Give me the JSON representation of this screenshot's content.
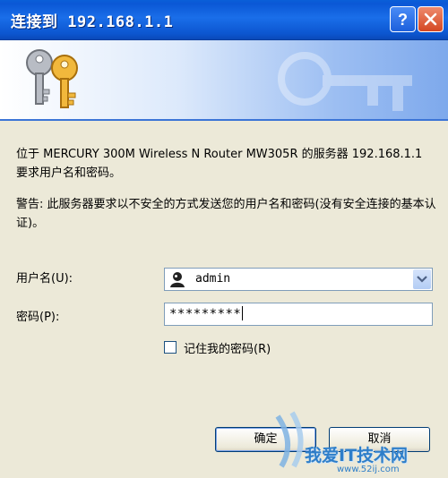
{
  "window": {
    "title": "连接到 192.168.1.1",
    "help_icon": "help-icon",
    "close_icon": "close-icon"
  },
  "banner": {
    "icon": "keys-icon"
  },
  "message": {
    "line1": "位于 MERCURY 300M Wireless N Router MW305R 的服务器 192.168.1.1 要求用户名和密码。",
    "warning": "警告: 此服务器要求以不安全的方式发送您的用户名和密码(没有安全连接的基本认证)。"
  },
  "form": {
    "username_label": "用户名(U):",
    "username_value": "admin",
    "password_label": "密码(P):",
    "password_value": "*********",
    "remember_label": "记住我的密码(R)",
    "remember_checked": false
  },
  "buttons": {
    "ok": "确定",
    "cancel": "取消"
  },
  "watermark": {
    "site_name": "我爱IT技术网",
    "site_url": "www.52ij.com"
  },
  "colors": {
    "titlebar": "#0b58d6",
    "dialog_bg": "#ece9d8",
    "close": "#d44722"
  }
}
